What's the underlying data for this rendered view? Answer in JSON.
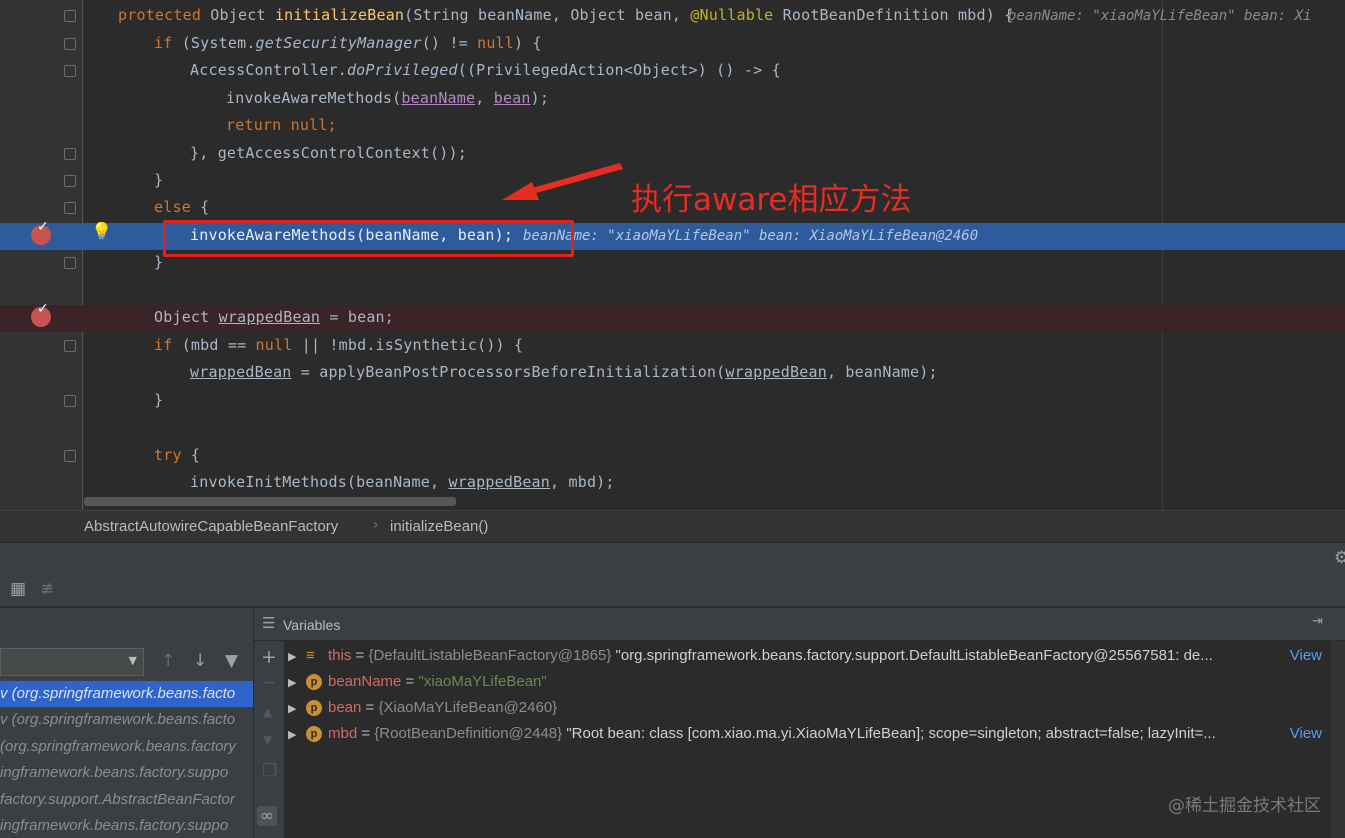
{
  "editor": {
    "lines": [
      {
        "indent": "",
        "hint": "beanName: \"xiaoMaYLifeBean\"  bean: Xi"
      },
      {
        "indent": "    "
      },
      {
        "indent": "        "
      },
      {
        "indent": "            "
      },
      {
        "indent": "            "
      },
      {
        "indent": "        "
      },
      {
        "indent": "    "
      },
      {
        "indent": "    "
      },
      {
        "indent": "        ",
        "hint": "beanName: \"xiaoMaYLifeBean\"  bean: XiaoMaYLifeBean@2460"
      },
      {
        "indent": "    "
      },
      {},
      {
        "indent": "    "
      },
      {
        "indent": "    "
      },
      {
        "indent": "        "
      },
      {
        "indent": "    "
      },
      {},
      {
        "indent": "    "
      },
      {
        "indent": "        "
      }
    ],
    "t": {
      "protected": "protected",
      "object_sp": " Object ",
      "initializeBean": "initializeBean",
      "sig_mid": "(String beanName, Object bean, ",
      "nullable": "@Nullable",
      "sig_end": " RootBeanDefinition mbd) {",
      "if": "if",
      "sys_open": " (System.",
      "getSecurityManager": "getSecurityManager",
      "ne": "() != ",
      "null": "null",
      "paren_brace": ") {",
      "access": "AccessController.",
      "doPrivileged": "doPrivileged",
      "priv": "((PrivilegedAction<Object>) () -> {",
      "invokeAware": "invokeAwareMethods(",
      "beanName": "beanName",
      "comma": ", ",
      "bean": "bean",
      "close_semi": ");",
      "return": "return",
      "sp": " ",
      "semi": ";",
      "ctx": "}, getAccessControlContext());",
      "rbrace": "}",
      "else": "else",
      "lbrace": " {",
      "exec_call": "invokeAwareMethods(beanName, bean);",
      "obj_decl": "Object ",
      "wrappedBean": "wrappedBean",
      "eq_bean": " = bean;",
      "mbd_eq": " (mbd == ",
      "or_synth": " || !mbd.isSynthetic()) {",
      "apply": " = applyBeanPostProcessorsBeforeInitialization(",
      "beanName_close": ", beanName);",
      "try": "try",
      "invokeInit": "invokeInitMethods(beanName, ",
      "mbd_close": ", mbd);"
    }
  },
  "annotation": {
    "text": "执行aware相应方法",
    "color": "#e72c22"
  },
  "breadcrumb": {
    "class_name": "AbstractAutowireCapableBeanFactory",
    "method_name": "initializeBean()"
  },
  "frames": {
    "items": [
      {
        "label": "v (org.springframework.beans.facto",
        "selected": true
      },
      {
        "label": "v (org.springframework.beans.facto"
      },
      {
        "label": "(org.springframework.beans.factory"
      },
      {
        "label": "ingframework.beans.factory.suppo"
      },
      {
        "label": "factory.support.AbstractBeanFactor"
      },
      {
        "label": "ingframework.beans.factory.suppo"
      }
    ]
  },
  "variables": {
    "title": "Variables",
    "view_link": "View",
    "rows": [
      {
        "name": "this",
        "eq": " = ",
        "type": "{DefaultListableBeanFactory@1865}",
        "value": " \"org.springframework.beans.factory.support.DefaultListableBeanFactory@25567581: de...",
        "has_view": true,
        "kind": "field"
      },
      {
        "name": "beanName",
        "eq": " = ",
        "str": "\"xiaoMaYLifeBean\"",
        "kind": "param"
      },
      {
        "name": "bean",
        "eq": " = ",
        "type": "{XiaoMaYLifeBean@2460}",
        "kind": "param"
      },
      {
        "name": "mbd",
        "eq": " = ",
        "type": "{RootBeanDefinition@2448}",
        "value": " \"Root bean: class [com.xiao.ma.yi.XiaoMaYLifeBean]; scope=singleton; abstract=false; lazyInit=...",
        "has_view": true,
        "kind": "param"
      }
    ]
  },
  "watermark": "@稀土掘金技术社区",
  "colors": {
    "editor_bg": "#2b2b2b",
    "exec_line": "#2e5b9c",
    "breakpoint": "#c75450",
    "keyword": "#cc7832",
    "method": "#ffc66d",
    "selection": "#2f65ca"
  }
}
